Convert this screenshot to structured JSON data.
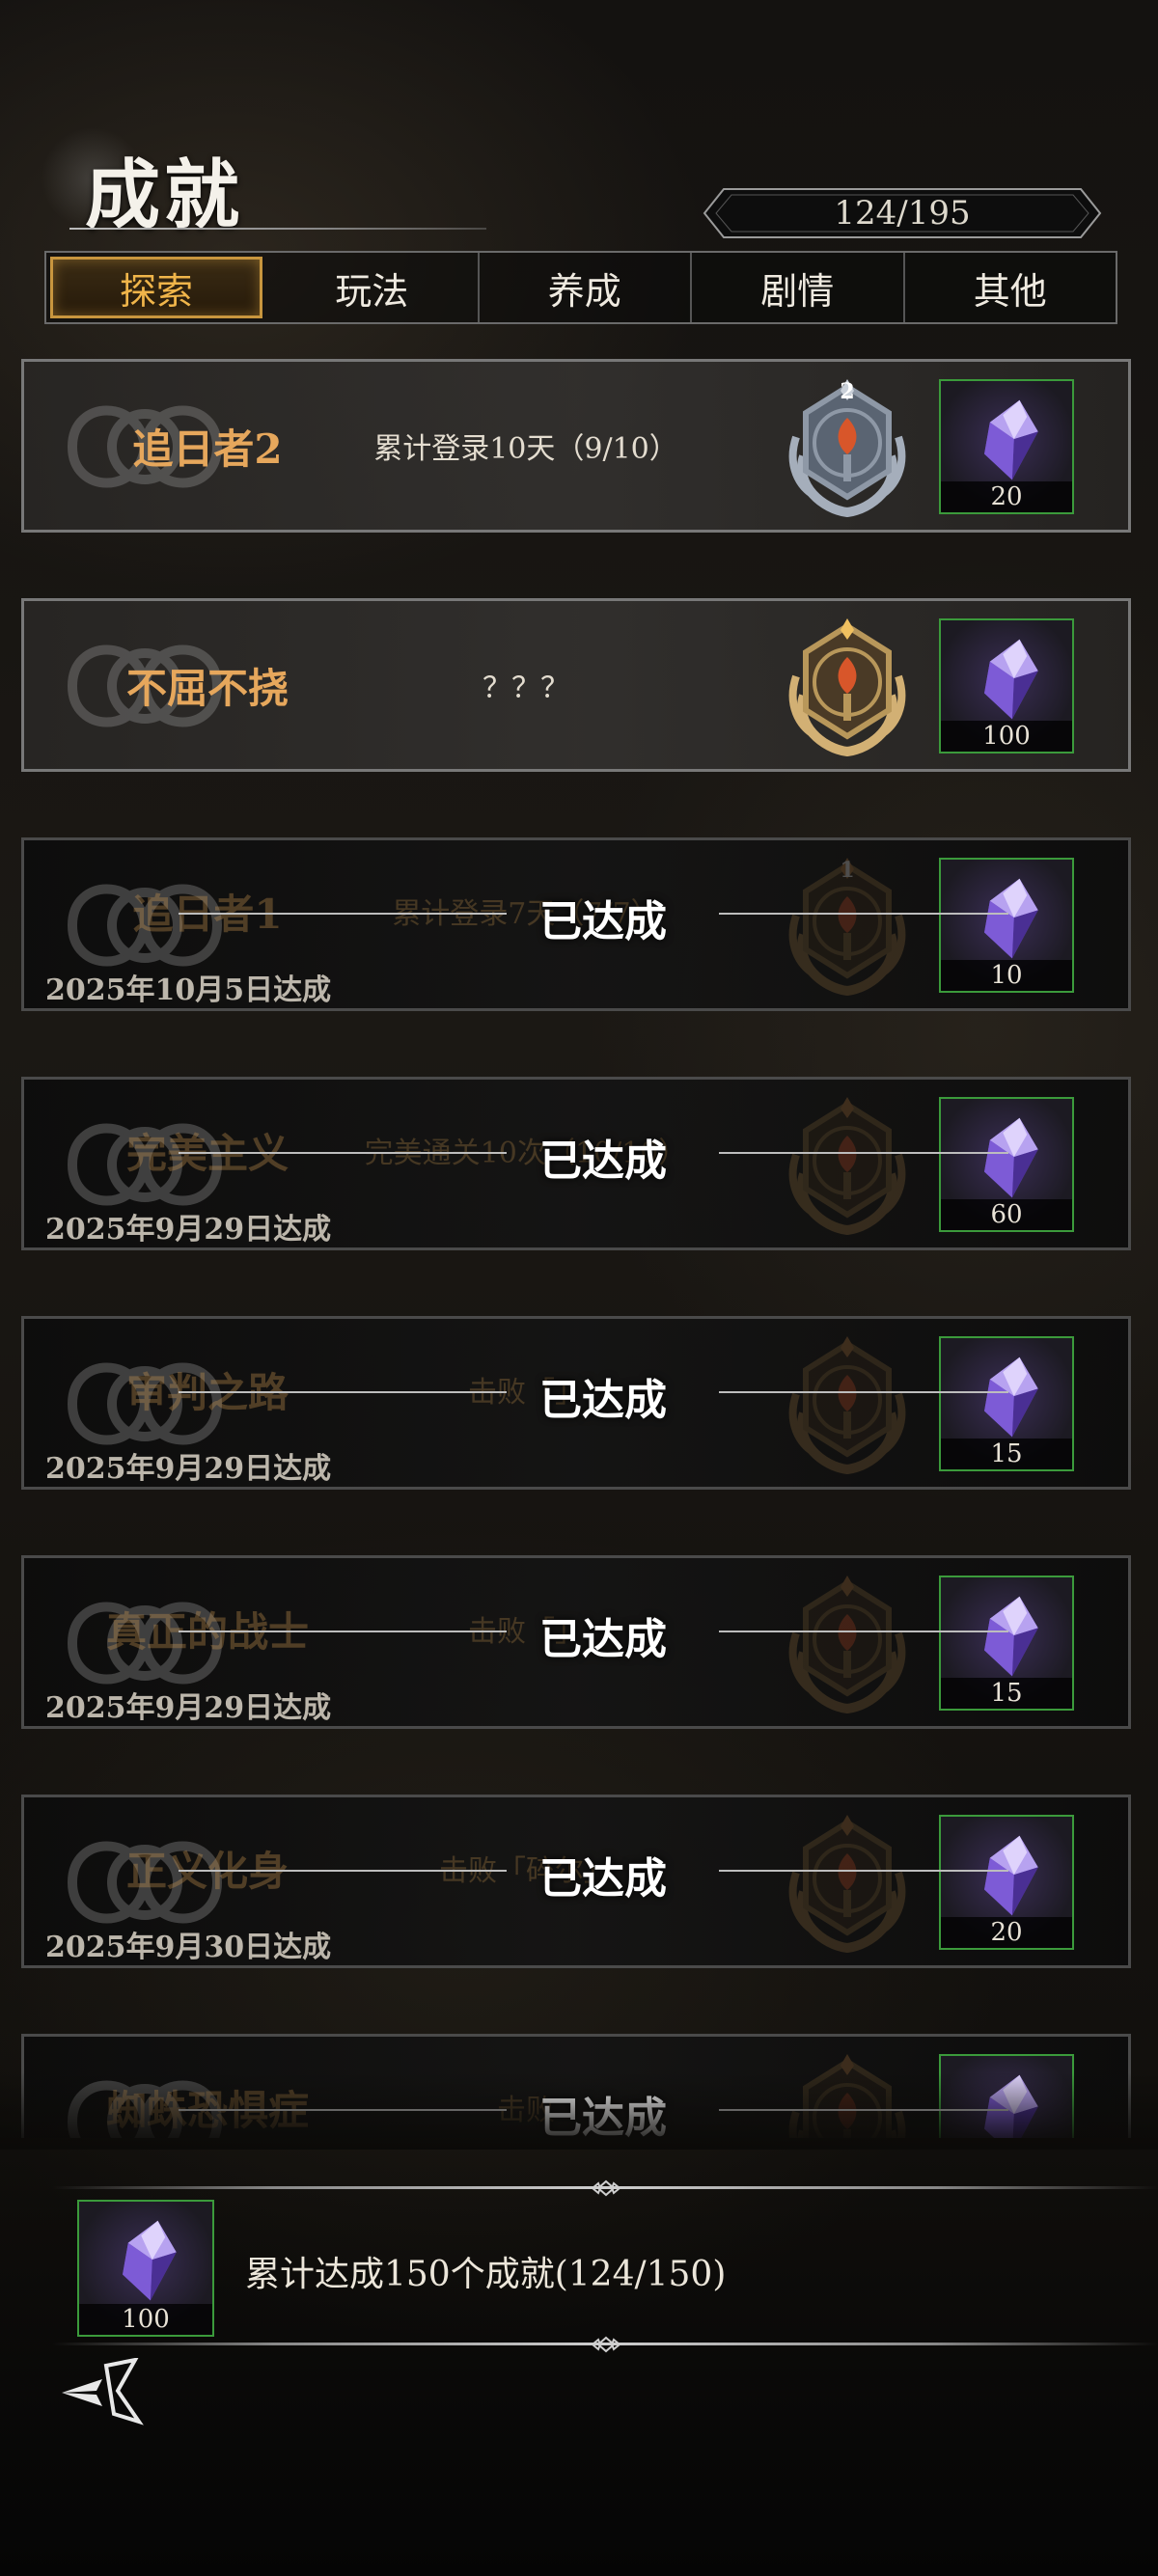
{
  "header": {
    "title": "成就",
    "progress": "124/195"
  },
  "tabs": [
    {
      "label": "探索",
      "active": true
    },
    {
      "label": "玩法",
      "active": false
    },
    {
      "label": "养成",
      "active": false
    },
    {
      "label": "剧情",
      "active": false
    },
    {
      "label": "其他",
      "active": false
    }
  ],
  "achievements": [
    {
      "name": "追日者2",
      "desc": "累计登录10天（9/10）",
      "medal": "silver-torch-medal-icon",
      "medal_level": "2",
      "reward": "20",
      "completed": false
    },
    {
      "name": "不屈不挠",
      "desc": "？？？",
      "medal": "gold-torch-medal-icon",
      "medal_level": "",
      "reward": "100",
      "completed": false
    },
    {
      "name": "追日者1",
      "desc": "累计登录7天（7/7）",
      "medal": "bronze-torch-medal-icon",
      "medal_level": "1",
      "reward": "10",
      "completed": true,
      "status": "已达成",
      "date": "2025年10月5日达成"
    },
    {
      "name": "完美主义",
      "desc": "完美通关10次（10/10）",
      "medal": "bronze-torch-medal-icon",
      "medal_level": "",
      "reward": "60",
      "completed": true,
      "status": "已达成",
      "date": "2025年9月29日达成"
    },
    {
      "name": "审判之路",
      "desc": "击败「」",
      "medal": "bronze-torch-medal-icon",
      "medal_level": "",
      "reward": "15",
      "completed": true,
      "status": "已达成",
      "date": "2025年9月29日达成"
    },
    {
      "name": "真正的战士",
      "desc": "击败「」",
      "medal": "bronze-torch-medal-icon",
      "medal_level": "",
      "reward": "15",
      "completed": true,
      "status": "已达成",
      "date": "2025年9月29日达成"
    },
    {
      "name": "正义化身",
      "desc": "击败「碎尔」",
      "medal": "bronze-torch-medal-icon",
      "medal_level": "",
      "reward": "20",
      "completed": true,
      "status": "已达成",
      "date": "2025年9月30日达成"
    },
    {
      "name": "蜘蛛恐惧症",
      "desc": "击败",
      "medal": "bronze-torch-medal-icon",
      "medal_level": "",
      "reward": "",
      "completed": true,
      "status": "已达成",
      "date": ""
    }
  ],
  "summary": {
    "reward": "100",
    "text": "累计达成150个成就(124/150)"
  },
  "icons": {
    "reward": "purple-crystal-icon",
    "back": "back-arrow-icon",
    "card_decor": "celtic-knot-icon"
  },
  "colors": {
    "accent_gold": "#c8963e",
    "name_orange": "#e6a75c",
    "reward_border": "#3b9a3b",
    "crystal": "#7a55c8"
  }
}
